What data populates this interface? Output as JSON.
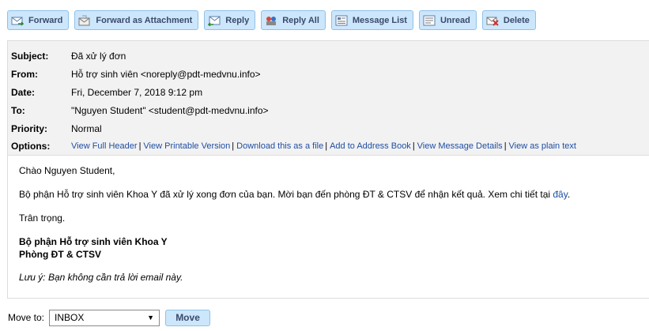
{
  "toolbar": {
    "forward": "Forward",
    "forward_attachment": "Forward as Attachment",
    "reply": "Reply",
    "reply_all": "Reply All",
    "message_list": "Message List",
    "unread": "Unread",
    "delete": "Delete"
  },
  "header": {
    "subject_label": "Subject:",
    "subject": "Đã xử lý đơn",
    "from_label": "From:",
    "from": "Hỗ trợ sinh viên <noreply@pdt-medvnu.info>",
    "date_label": "Date:",
    "date": "Fri, December 7, 2018 9:12 pm",
    "to_label": "To:",
    "to": "\"Nguyen Student\" <student@pdt-medvnu.info>",
    "priority_label": "Priority:",
    "priority": "Normal",
    "options_label": "Options:",
    "options": [
      "View Full Header",
      "View Printable Version",
      "Download this as a file",
      "Add to Address Book",
      "View Message Details",
      "View as plain text"
    ]
  },
  "body": {
    "greeting": "Chào Nguyen Student,",
    "paragraph": "Bộ phận Hỗ trợ sinh viên Khoa Y đã xử lý xong đơn của bạn. Mời bạn đến phòng ĐT & CTSV để nhận kết quả. Xem chi tiết tại ",
    "link": "đây",
    "after_link": ".",
    "closing": "Trân trọng.",
    "signature_line1": "Bộ phận Hỗ trợ sinh viên Khoa Y",
    "signature_line2": "Phòng ĐT & CTSV",
    "note": "Lưu ý: Bạn không cần trả lời email này."
  },
  "move": {
    "label": "Move to:",
    "selected": "INBOX",
    "button": "Move"
  },
  "colors": {
    "button_bg": "#cce6fb",
    "button_border": "#8fc2e8",
    "link": "#1f4ea3",
    "header_bg": "#f2f2f2"
  }
}
